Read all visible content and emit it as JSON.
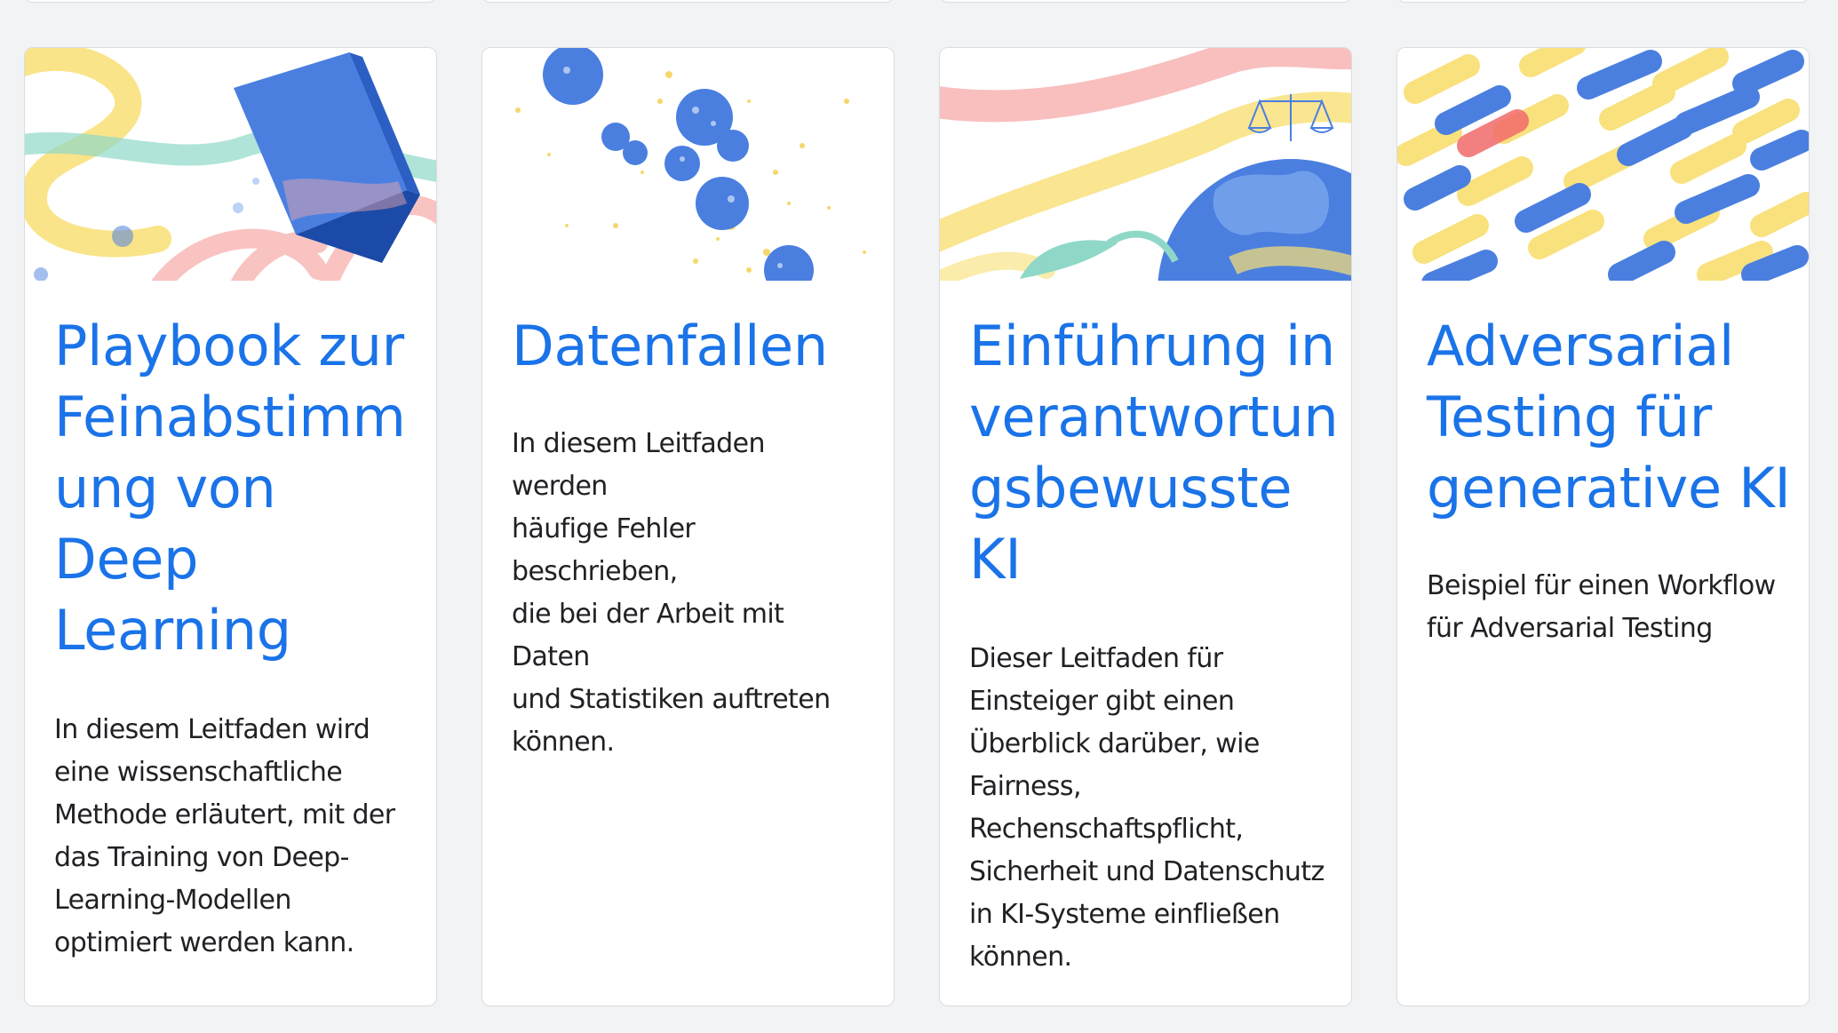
{
  "cards": [
    {
      "title_lines": [
        "Playbook zur",
        "Feinabstimm",
        "ung von",
        "Deep",
        "Learning"
      ],
      "description_lines": [
        "In diesem Leitfaden wird",
        "eine wissenschaftliche",
        "Methode erläutert, mit der",
        "das Training von Deep-",
        "Learning-Modellen",
        "optimiert werden kann."
      ],
      "illustration": "blue-book-with-swirls"
    },
    {
      "title_lines": [
        "Datenfallen"
      ],
      "description_lines": [
        "In diesem Leitfaden werden",
        "häufige Fehler beschrieben,",
        "die bei der Arbeit mit Daten",
        "und Statistiken auftreten",
        "können."
      ],
      "illustration": "blue-dots-yellow-specks"
    },
    {
      "title_lines": [
        "Einführung in",
        "verantwortun",
        "gsbewusste",
        "KI"
      ],
      "description_lines": [
        "Dieser Leitfaden für",
        "Einsteiger gibt einen",
        "Überblick darüber, wie",
        "Fairness,",
        "Rechenschaftspflicht,",
        "Sicherheit und Datenschutz",
        "in KI-Systeme einfließen",
        "können."
      ],
      "illustration": "globe-with-scales"
    },
    {
      "title_lines": [
        "Adversarial",
        "Testing für",
        "generative KI"
      ],
      "description_lines": [
        "Beispiel für einen Workflow",
        "für Adversarial Testing"
      ],
      "illustration": "diagonal-brush-strokes"
    }
  ],
  "colors": {
    "title": "#1a73e8",
    "body_text": "#202124",
    "card_border": "#dadce0",
    "page_background": "#f1f3f4",
    "art_blue": "#4a7fe0",
    "art_yellow": "#f9df74",
    "art_pink": "#f6aaa8",
    "art_teal": "#8fd8c8",
    "art_red": "#f26b6b"
  }
}
